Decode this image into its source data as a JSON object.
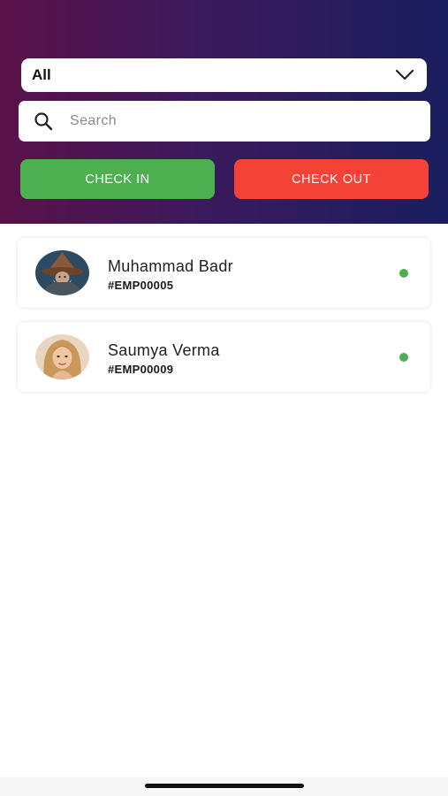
{
  "filter": {
    "selected": "All"
  },
  "search": {
    "placeholder": "Search",
    "value": ""
  },
  "actions": {
    "check_in_label": "CHECK IN",
    "check_out_label": "CHECK OUT"
  },
  "colors": {
    "check_in": "#4caf50",
    "check_out": "#f44336",
    "status_active": "#4caf50"
  },
  "employees": [
    {
      "name": "Muhammad Badr",
      "id": "#EMP00005",
      "status": "active",
      "avatar_icon": "wizard-avatar"
    },
    {
      "name": "Saumya Verma",
      "id": "#EMP00009",
      "status": "active",
      "avatar_icon": "woman-avatar"
    }
  ]
}
